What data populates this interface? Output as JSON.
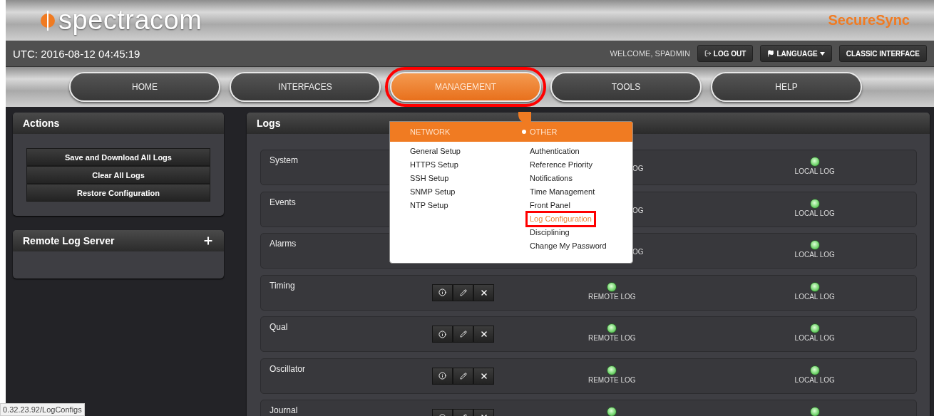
{
  "header": {
    "logo": "spectracom",
    "product": "SecureSync"
  },
  "top_bar": {
    "utc": "UTC: 2016-08-12 04:45:19",
    "welcome": "WELCOME, SPADMIN",
    "buttons": [
      {
        "label": "LOG OUT",
        "kind": "logout"
      },
      {
        "label": "LANGUAGE",
        "kind": "language"
      },
      {
        "label": "CLASSIC INTERFACE",
        "kind": "plain"
      }
    ]
  },
  "nav": [
    {
      "label": "HOME",
      "selected": false,
      "annotated": false
    },
    {
      "label": "INTERFACES",
      "selected": false,
      "annotated": false
    },
    {
      "label": "MANAGEMENT",
      "selected": true,
      "annotated": true
    },
    {
      "label": "TOOLS",
      "selected": false,
      "annotated": false
    },
    {
      "label": "HELP",
      "selected": false,
      "annotated": false
    }
  ],
  "menu": {
    "columns": [
      {
        "heading": "NETWORK",
        "current": false,
        "items": [
          {
            "label": "General Setup",
            "selected": false,
            "annotated": false
          },
          {
            "label": "HTTPS Setup",
            "selected": false,
            "annotated": false
          },
          {
            "label": "SSH Setup",
            "selected": false,
            "annotated": false
          },
          {
            "label": "SNMP Setup",
            "selected": false,
            "annotated": false
          },
          {
            "label": "NTP Setup",
            "selected": false,
            "annotated": false
          }
        ]
      },
      {
        "heading": "OTHER",
        "current": true,
        "items": [
          {
            "label": "Authentication",
            "selected": false,
            "annotated": false
          },
          {
            "label": "Reference Priority",
            "selected": false,
            "annotated": false
          },
          {
            "label": "Notifications",
            "selected": false,
            "annotated": false
          },
          {
            "label": "Time Management",
            "selected": false,
            "annotated": false
          },
          {
            "label": "Front Panel",
            "selected": false,
            "annotated": false
          },
          {
            "label": "Log Configuration",
            "selected": true,
            "annotated": true
          },
          {
            "label": "Disciplining",
            "selected": false,
            "annotated": false
          },
          {
            "label": "Change My Password",
            "selected": false,
            "annotated": false
          }
        ]
      }
    ]
  },
  "actions": {
    "title": "Actions",
    "buttons": [
      "Save and Download All Logs",
      "Clear All Logs",
      "Restore Configuration"
    ]
  },
  "remote_log_server": {
    "title": "Remote Log Server"
  },
  "logs": {
    "title": "Logs",
    "rows": [
      {
        "name": "System",
        "kind": "covered",
        "remote": {
          "label": "OG"
        },
        "local": {
          "label": "LOCAL LOG",
          "on": true
        }
      },
      {
        "name": "Events",
        "kind": "covered",
        "remote": {
          "label": "OG"
        },
        "local": {
          "label": "LOCAL LOG",
          "on": true
        }
      },
      {
        "name": "Alarms",
        "kind": "covered",
        "remote": {
          "label": "OG"
        },
        "local": {
          "label": "LOCAL LOG",
          "on": true
        }
      },
      {
        "name": "Timing",
        "kind": "full",
        "remote": {
          "label": "REMOTE LOG",
          "on": true
        },
        "local": {
          "label": "LOCAL LOG",
          "on": true
        }
      },
      {
        "name": "Qual",
        "kind": "full",
        "remote": {
          "label": "REMOTE LOG",
          "on": true
        },
        "local": {
          "label": "LOCAL LOG",
          "on": true
        }
      },
      {
        "name": "Oscillator",
        "kind": "full",
        "remote": {
          "label": "REMOTE LOG",
          "on": true
        },
        "local": {
          "label": "LOCAL LOG",
          "on": true
        }
      },
      {
        "name": "Journal",
        "kind": "full",
        "remote": {
          "on": true
        },
        "local": {
          "on": true
        }
      }
    ]
  },
  "status_url": "0.32.23.92/LogConfigs"
}
